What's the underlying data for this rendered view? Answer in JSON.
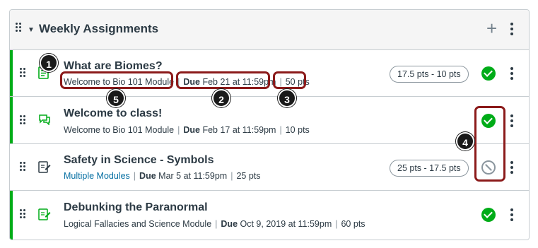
{
  "group": {
    "title": "Weekly Assignments",
    "icons": {
      "drag": "drag-handle-icon",
      "collapse": "caret-down-icon",
      "add": "plus-icon",
      "options": "kebab-icon"
    }
  },
  "items": [
    {
      "title": "What are Biomes?",
      "module": "Welcome to Bio 101 Module",
      "due_label": "Due",
      "due_date": "Feb 21 at 11:59pm",
      "points": "50 pts",
      "pill": "17.5 pts - 10 pts",
      "status": "published",
      "icon": "quiz-icon"
    },
    {
      "title": "Welcome to class!",
      "module": "Welcome to Bio 101 Module",
      "due_label": "Due",
      "due_date": "Feb 17 at 11:59pm",
      "points": "10 pts",
      "status": "published",
      "icon": "discussion-icon"
    },
    {
      "title": "Safety in Science - Symbols",
      "module": "Multiple Modules",
      "due_label": "Due",
      "due_date": "Mar 5 at 11:59pm",
      "points": "25 pts",
      "pill": "25 pts - 17.5 pts",
      "status": "unpublished",
      "icon": "assignment-icon"
    },
    {
      "title": "Debunking the Paranormal",
      "module": "Logical Fallacies and Science Module",
      "due_label": "Due",
      "due_date": "Oct 9, 2019 at 11:59pm",
      "points": "60 pts",
      "status": "published",
      "icon": "assignment-icon"
    }
  ],
  "callouts": [
    "1",
    "2",
    "3",
    "4",
    "5"
  ],
  "colors": {
    "published": "#00ac18",
    "link": "#0770a3",
    "callout": "#8b1a1a"
  }
}
